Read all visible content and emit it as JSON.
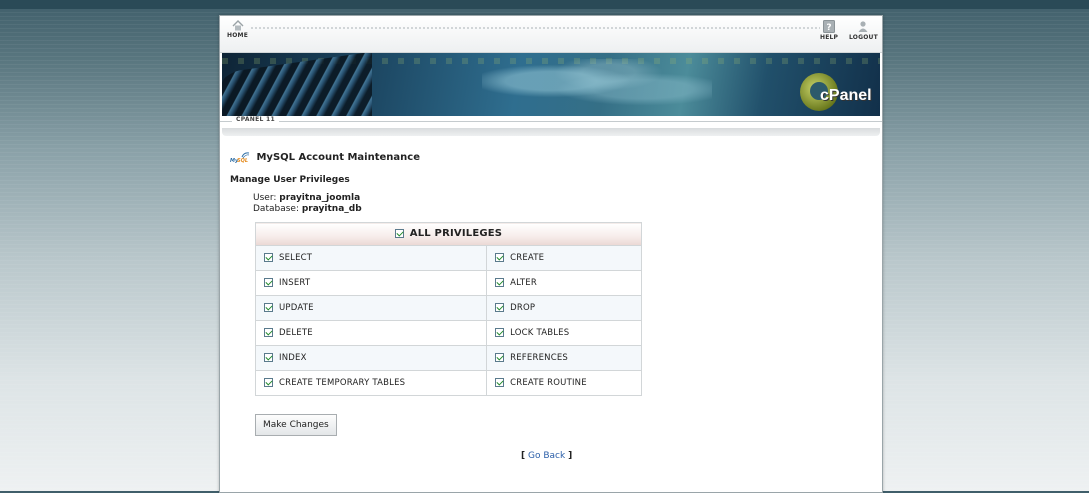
{
  "nav": {
    "home_label": "HOME",
    "help_label": "HELP",
    "logout_label": "LOGOUT"
  },
  "banner": {
    "logo_text": "cPanel",
    "version": "CPANEL 11"
  },
  "page": {
    "title": "MySQL Account Maintenance",
    "section_title": "Manage User Privileges",
    "user_label": "User:",
    "user_value": "prayitna_joomla",
    "database_label": "Database:",
    "database_value": "prayitna_db"
  },
  "privileges": {
    "all_label": "ALL PRIVILEGES",
    "all_checked": true,
    "rows": [
      {
        "left": "SELECT",
        "right": "CREATE"
      },
      {
        "left": "INSERT",
        "right": "ALTER"
      },
      {
        "left": "UPDATE",
        "right": "DROP"
      },
      {
        "left": "DELETE",
        "right": "LOCK TABLES"
      },
      {
        "left": "INDEX",
        "right": "REFERENCES"
      },
      {
        "left": "CREATE TEMPORARY TABLES",
        "right": "CREATE ROUTINE"
      }
    ]
  },
  "actions": {
    "submit_label": "Make Changes",
    "go_back_label": "Go Back",
    "bracket_open": "[",
    "bracket_close": "]"
  },
  "colors": {
    "link": "#2a5ea8",
    "check": "#1f8a2a"
  }
}
